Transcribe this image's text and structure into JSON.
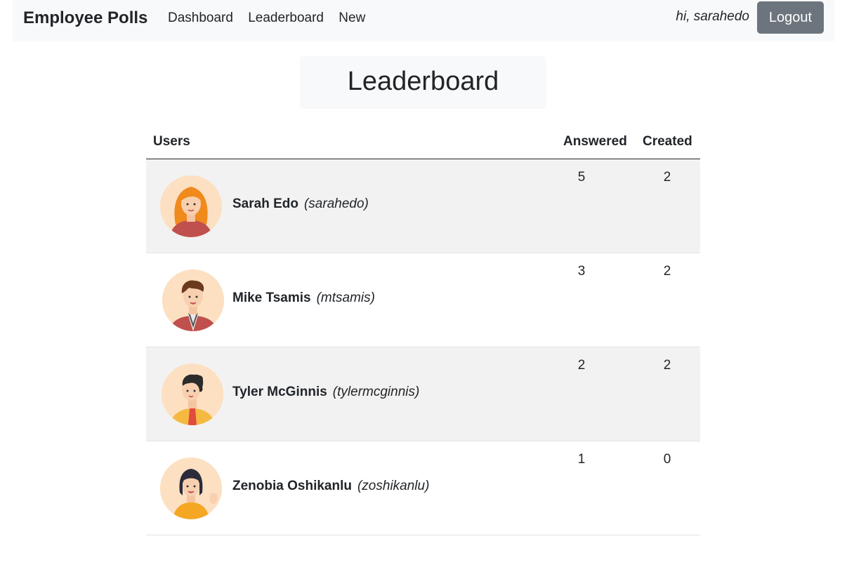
{
  "navbar": {
    "brand": "Employee Polls",
    "links": [
      "Dashboard",
      "Leaderboard",
      "New"
    ],
    "greeting": "hi, sarahedo",
    "logout_label": "Logout"
  },
  "page": {
    "title": "Leaderboard"
  },
  "table": {
    "headers": {
      "users": "Users",
      "answered": "Answered",
      "created": "Created"
    },
    "rows": [
      {
        "name": "Sarah Edo",
        "handle": "(sarahedo)",
        "answered": "5",
        "created": "2",
        "avatar_icon": "woman-orange-hair-avatar"
      },
      {
        "name": "Mike Tsamis",
        "handle": "(mtsamis)",
        "answered": "3",
        "created": "2",
        "avatar_icon": "man-brown-hair-avatar"
      },
      {
        "name": "Tyler McGinnis",
        "handle": "(tylermcginnis)",
        "answered": "2",
        "created": "2",
        "avatar_icon": "man-curly-hair-avatar"
      },
      {
        "name": "Zenobia Oshikanlu",
        "handle": "(zoshikanlu)",
        "answered": "1",
        "created": "0",
        "avatar_icon": "woman-dark-hair-waving-avatar"
      }
    ]
  },
  "colors": {
    "navbar_bg": "#f8f9fa",
    "logout_bg": "#6c757d",
    "stripe_bg": "#f2f2f2",
    "avatar_bg": "#fde0c2"
  }
}
